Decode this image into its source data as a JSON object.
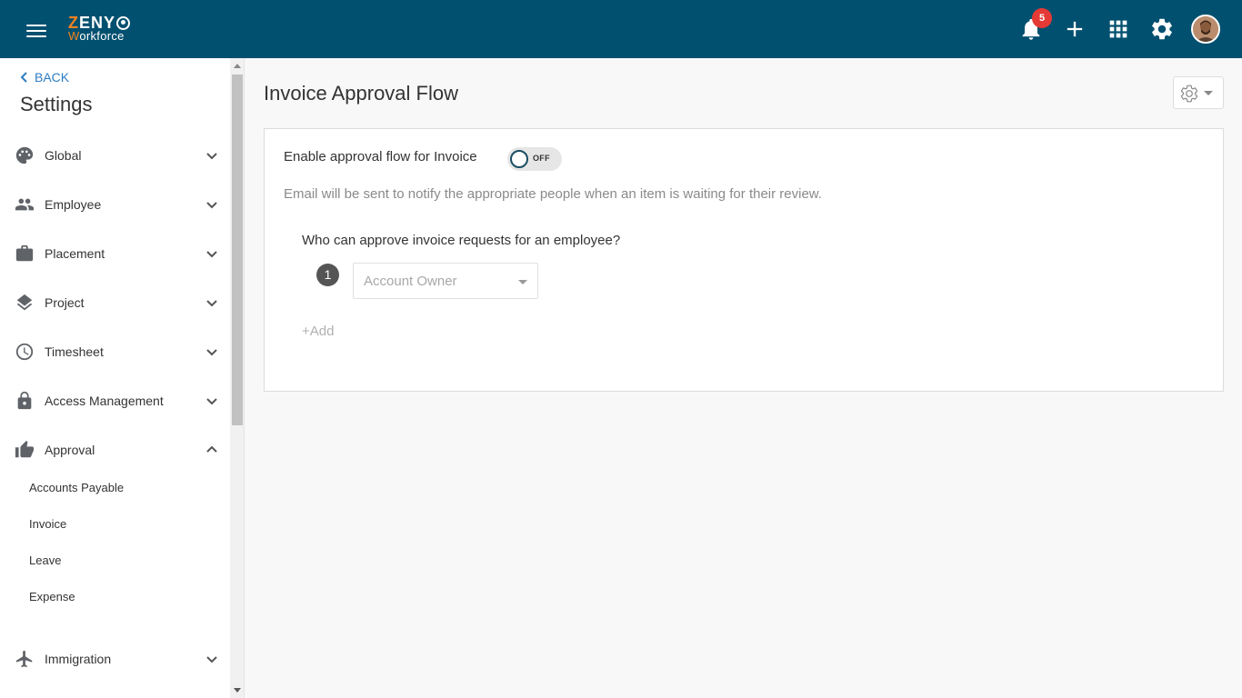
{
  "brand": {
    "line1_first": "Z",
    "line1_rest": "ENY",
    "line2_first": "W",
    "line2_rest": "orkforce"
  },
  "topbar": {
    "notification_count": "5",
    "icons": [
      "menu-icon",
      "bell-icon",
      "plus-icon",
      "apps-grid-icon",
      "gear-icon",
      "avatar"
    ]
  },
  "sidebar": {
    "back_label": "BACK",
    "title": "Settings",
    "items": [
      {
        "label": "Global",
        "icon": "palette-icon"
      },
      {
        "label": "Employee",
        "icon": "people-icon"
      },
      {
        "label": "Placement",
        "icon": "briefcase-icon"
      },
      {
        "label": "Project",
        "icon": "layers-icon"
      },
      {
        "label": "Timesheet",
        "icon": "clock-icon"
      },
      {
        "label": "Access Management",
        "icon": "lock-icon"
      },
      {
        "label": "Approval",
        "icon": "thumbs-up-icon",
        "expanded": true
      },
      {
        "label": "Immigration",
        "icon": "airplane-icon"
      }
    ],
    "approval_subitems": [
      "Accounts Payable",
      "Invoice",
      "Leave",
      "Expense"
    ]
  },
  "main": {
    "title": "Invoice Approval Flow",
    "enable_label": "Enable approval flow for Invoice",
    "toggle_state": "OFF",
    "hint": "Email will be sent to notify the appropriate people when an item is waiting for their review.",
    "question": "Who can approve invoice requests for an employee?",
    "step_number": "1",
    "approver_value": "Account Owner",
    "add_label": "+Add"
  },
  "colors": {
    "topbar_bg": "#02506f",
    "brand_accent": "#f58220",
    "link": "#2e7ec1",
    "badge": "#e53935"
  }
}
